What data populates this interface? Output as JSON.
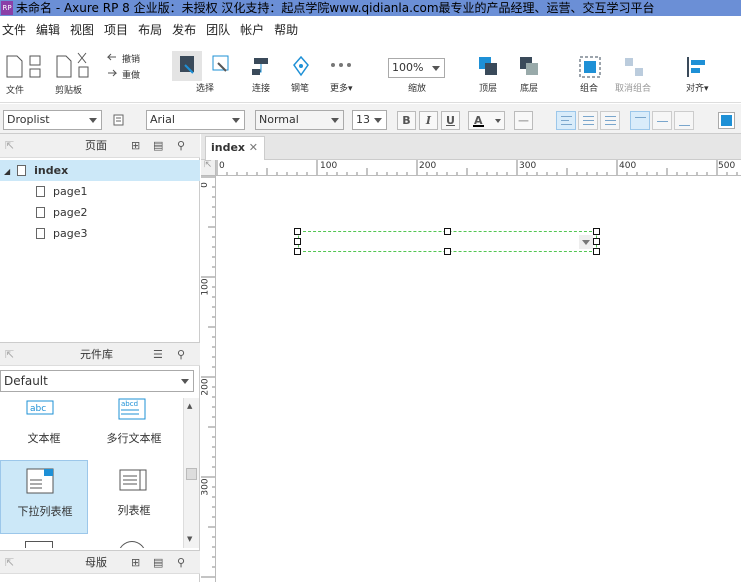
{
  "window": {
    "title": "未命名 - Axure RP 8 企业版：未授权 汉化支持：起点学院www.qidianla.com最专业的产品经理、运营、交互学习平台",
    "logo": "RP"
  },
  "menu": [
    "文件",
    "编辑",
    "视图",
    "项目",
    "布局",
    "发布",
    "团队",
    "帐户",
    "帮助"
  ],
  "toolbar": {
    "file": "文件",
    "clipboard": "剪贴板",
    "undo": "撤销",
    "redo": "重做",
    "select": "选择",
    "connect": "连接",
    "pen": "钢笔",
    "more": "更多▾",
    "zoom_value": "100%",
    "zoom_label": "缩放",
    "top": "顶层",
    "bottom": "底层",
    "group": "组合",
    "ungroup": "取消组合",
    "align": "对齐▾"
  },
  "format": {
    "widget_type": "Droplist",
    "font": "Arial",
    "style": "Normal",
    "size": "13",
    "bold": "B",
    "italic": "I",
    "underline": "U",
    "font_color": "A"
  },
  "pages_panel": {
    "title": "页面",
    "pages": [
      {
        "name": "index",
        "selected": true
      },
      {
        "name": "page1"
      },
      {
        "name": "page2"
      },
      {
        "name": "page3"
      }
    ]
  },
  "widgets_panel": {
    "title": "元件库",
    "library": "Default",
    "items": [
      {
        "label": "文本框",
        "icon": "abc"
      },
      {
        "label": "多行文本框",
        "icon": "abcd"
      },
      {
        "label": "下拉列表框",
        "selected": true
      },
      {
        "label": "列表框"
      }
    ]
  },
  "masters_panel": {
    "title": "母版"
  },
  "canvas": {
    "tab": "index",
    "h_ruler": [
      "0",
      "100",
      "200",
      "300",
      "400",
      "500"
    ],
    "v_ruler": [
      "0",
      "100",
      "200",
      "300"
    ]
  },
  "colors": {
    "accent": "#1e90d6",
    "selection": "#cce8f8",
    "title_bar": "#6b8fd6"
  }
}
